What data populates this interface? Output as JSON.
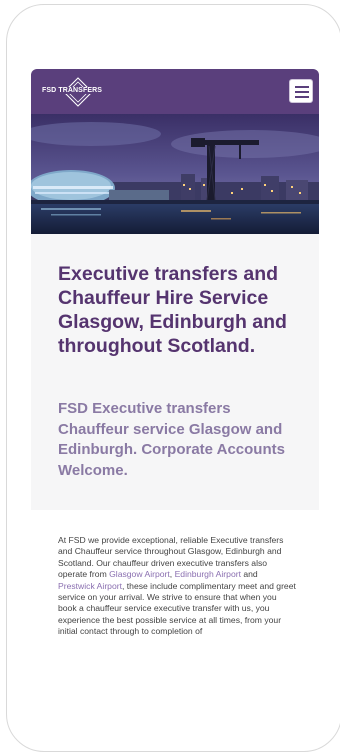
{
  "header": {
    "logo_text": "FSD TRANSFERS",
    "menu_label": "menu"
  },
  "hero": {
    "image_description": "Glasgow riverside at dusk with the SSE Hydro arena and Finnieston crane"
  },
  "intro": {
    "headline": "Executive transfers and Chauffeur Hire Service Glasgow, Edinburgh and throughout Scotland.",
    "subheadline": "FSD Executive transfers Chauffeur service Glasgow and Edinburgh. Corporate Accounts Welcome."
  },
  "body": {
    "part1": "At FSD we provide exceptional, reliable Executive transfers and Chauffeur service throughout Glasgow, Edinburgh and Scotland. Our chauffeur driven executive transfers also operate from ",
    "link_glasgow": "Glasgow Airport",
    "sep1": ", ",
    "link_edinburgh": "Edinburgh Airport",
    "sep2": " and ",
    "link_prestwick": "Prestwick Airport",
    "part2": ", these include complimentary meet and greet service on your arrival. We strive to ensure that when you book a chauffeur service executive transfer with us, you experience the best possible service at all times, from your initial contact through to completion of"
  },
  "colors": {
    "brand_purple": "#5a3f7c",
    "headline": "#55346f",
    "subheadline": "#8a7aa4",
    "link": "#8a6fb0"
  }
}
